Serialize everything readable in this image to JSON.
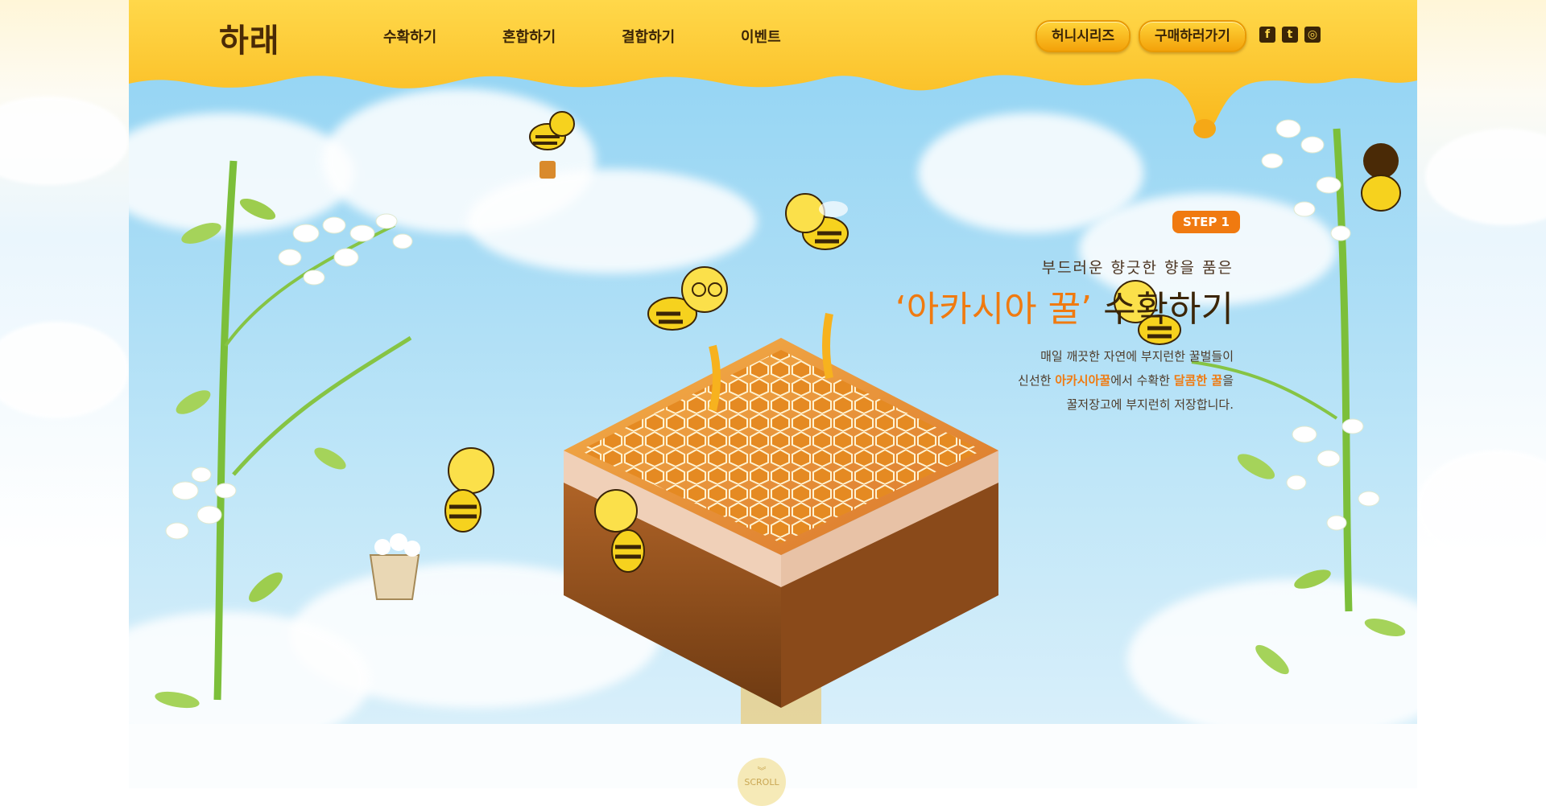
{
  "brand": {
    "logo": "하래"
  },
  "nav": {
    "items": [
      {
        "label": "수확하기"
      },
      {
        "label": "혼합하기"
      },
      {
        "label": "결합하기"
      },
      {
        "label": "이벤트"
      }
    ]
  },
  "header_buttons": {
    "honey_series": "허니시리즈",
    "buy": "구매하러가기"
  },
  "social": {
    "facebook": "f",
    "twitter": "t",
    "instagram": "◎"
  },
  "content": {
    "step": "STEP 1",
    "subtitle": "부드러운 향긋한 향을 품은",
    "title_accent": "‘아카시아 꿀’",
    "title_rest": "수확하기",
    "desc_line1": "매일 깨끗한 자연에 부지런한 꿀벌들이",
    "desc_line2_a": "신선한 ",
    "desc_line2_hl1": "아카시아꿀",
    "desc_line2_b": "에서 수확한 ",
    "desc_line2_hl2": "달콤한 꿀",
    "desc_line2_c": "을",
    "desc_line3": "꿀저장고에 부지런히 저장합니다."
  },
  "scroll": {
    "label": "SCROLL"
  },
  "colors": {
    "honey": "#ffc928",
    "accent": "#f07a10",
    "brown": "#3b2507",
    "sky": "#9ed8f4"
  }
}
